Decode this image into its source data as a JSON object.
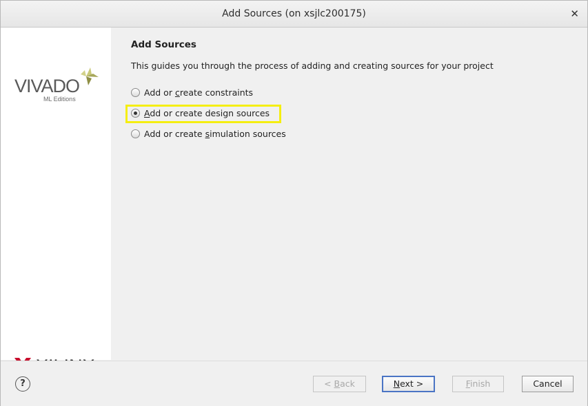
{
  "window": {
    "title": "Add Sources (on xsjlc200175)",
    "close_glyph": "✕"
  },
  "branding": {
    "vivado_word": "VIVADO",
    "vivado_sub": "ML Editions",
    "xilinx_word": "XILINX",
    "xilinx_mark": "."
  },
  "page": {
    "heading": "Add Sources",
    "description": "This guides you through the process of adding and creating sources for your project"
  },
  "options": [
    {
      "pre": "Add or ",
      "key": "c",
      "post": "reate constraints",
      "selected": false
    },
    {
      "pre": "",
      "key": "A",
      "post": "dd or create design sources",
      "selected": true
    },
    {
      "pre": "Add or create ",
      "key": "s",
      "post": "imulation sources",
      "selected": false
    }
  ],
  "buttons": {
    "help": "?",
    "back_pre": "< ",
    "back_key": "B",
    "back_post": "ack",
    "next_key": "N",
    "next_post": "ext >",
    "finish_key": "F",
    "finish_post": "inish",
    "cancel": "Cancel"
  },
  "colors": {
    "highlight": "#f5ee10",
    "primary_border": "#4a74c4",
    "xilinx_red": "#c8102e",
    "vivado_leaf": "#b5b56a"
  }
}
